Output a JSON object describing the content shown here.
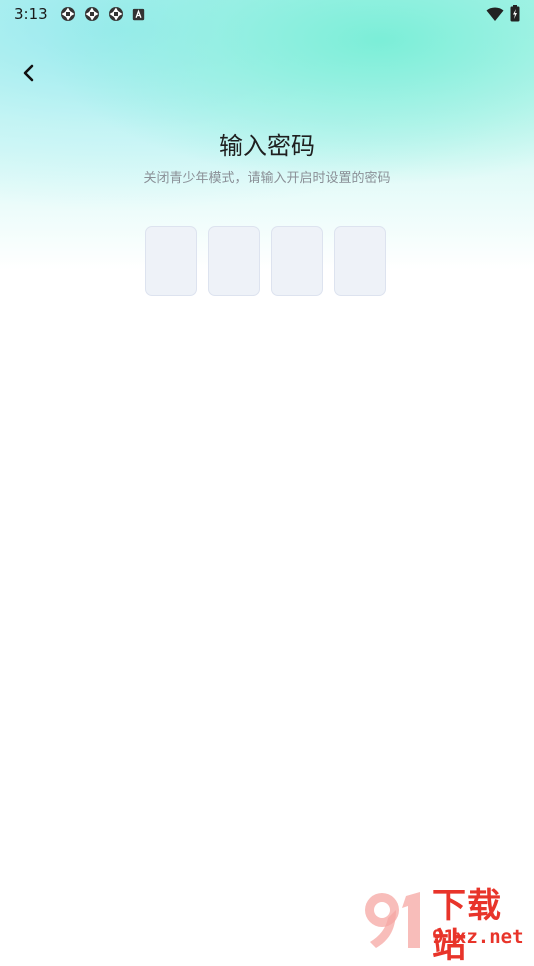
{
  "status_bar": {
    "time": "3:13",
    "icons": [
      "shutter-icon",
      "shutter-icon",
      "shutter-icon",
      "font-a-icon"
    ],
    "right_icons": [
      "wifi-icon",
      "battery-charging-icon"
    ]
  },
  "header": {
    "back_icon": "chevron-left-icon"
  },
  "main": {
    "title": "输入密码",
    "subtitle": "关闭青少年模式，请输入开启时设置的密码",
    "code_boxes": [
      "",
      "",
      "",
      ""
    ]
  },
  "watermark": {
    "brand_cn": "下载站",
    "domain": "91xz.net"
  },
  "colors": {
    "accent_gradient_top": "#8ff0dc",
    "code_box_bg": "#eef2f8",
    "code_box_border": "#dde3ef",
    "watermark_red": "#e8342a",
    "subtitle_gray": "#8a8f96"
  }
}
